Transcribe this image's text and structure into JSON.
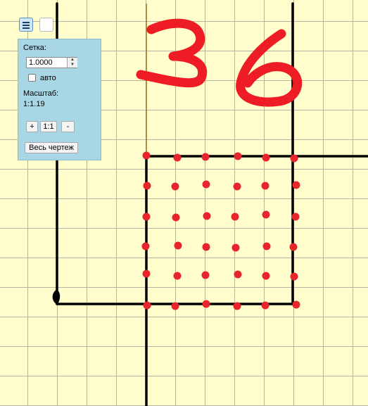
{
  "panel": {
    "grid_label": "Сетка:",
    "grid_value": "1.0000",
    "auto_label": "авто",
    "auto_checked": false,
    "scale_label": "Масштаб:",
    "scale_value": "1:1.19",
    "zoom_in_label": "+",
    "zoom_reset_label": "1:1",
    "zoom_out_label": "-",
    "fit_all_label": "Весь чертеж"
  },
  "drawing": {
    "annotation": "36",
    "annotation_color": "#ee1c24",
    "line_color": "#000000",
    "guide_color": "#a0701a",
    "point_color": "#e8242c",
    "point_rows": 6,
    "point_cols": 6,
    "point_count": 36
  },
  "colors": {
    "canvas_bg": "#fffecc",
    "grid_line": "#b6b6a0",
    "panel_bg": "#a9d6e5"
  }
}
